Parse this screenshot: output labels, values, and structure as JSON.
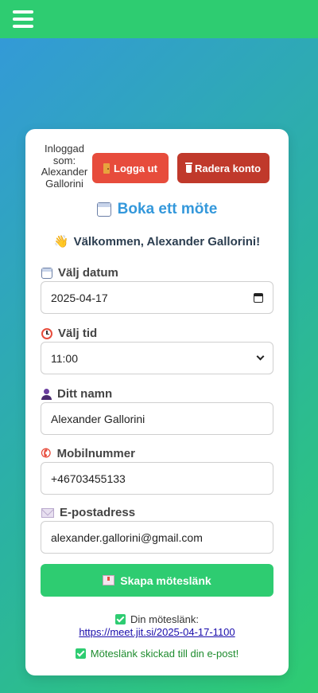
{
  "topbar": {
    "menu_icon": "hamburger-menu-icon"
  },
  "session": {
    "logged_in_text": "Inloggad som: Alexander Gallorini",
    "logout_label": "Logga ut",
    "delete_label": "Radera konto"
  },
  "booking": {
    "title": "Boka ett möte",
    "welcome": "Välkommen, Alexander Gallorini!",
    "date_label": "Välj datum",
    "date_value": "2025-04-17",
    "time_label": "Välj tid",
    "time_value": "11:00",
    "name_label": "Ditt namn",
    "name_value": "Alexander Gallorini",
    "phone_label": "Mobilnummer",
    "phone_value": "+46703455133",
    "email_label": "E-postadress",
    "email_value": "alexander.gallorini@gmail.com",
    "create_button": "Skapa möteslänk"
  },
  "result": {
    "link_label": "Din möteslänk:",
    "link_url": "https://meet.jit.si/2025-04-17-1100",
    "sent_message": "Möteslänk skickad till din e-post!"
  },
  "colors": {
    "topbar": "#2ecc71",
    "accent_blue": "#3498db",
    "logout_red": "#e74c3c",
    "delete_red": "#c0392b",
    "create_green": "#2ecc71",
    "success_green": "#1e8c2e"
  }
}
